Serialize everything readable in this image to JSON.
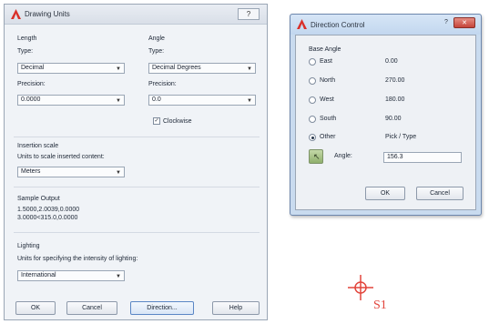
{
  "units_dialog": {
    "title": "Drawing Units",
    "help_label": "?",
    "length": {
      "group_label": "Length",
      "type_label": "Type:",
      "type_value": "Decimal",
      "precision_label": "Precision:",
      "precision_value": "0.0000"
    },
    "angle": {
      "group_label": "Angle",
      "type_label": "Type:",
      "type_value": "Decimal Degrees",
      "precision_label": "Precision:",
      "precision_value": "0.0",
      "clockwise_label": "Clockwise",
      "clockwise_checked": "✓"
    },
    "insertion": {
      "group_label": "Insertion scale",
      "desc": "Units to scale inserted content:",
      "value": "Meters"
    },
    "sample": {
      "group_label": "Sample Output",
      "line1": "1.5000,2.0039,0.0000",
      "line2": "3.0000<315.0,0.0000"
    },
    "lighting": {
      "group_label": "Lighting",
      "desc": "Units for specifying the intensity of lighting:",
      "value": "International"
    },
    "buttons": {
      "ok": "OK",
      "cancel": "Cancel",
      "direction": "Direction...",
      "help": "Help"
    }
  },
  "direction_dialog": {
    "title": "Direction Control",
    "help_label": "?",
    "close_label": "✕",
    "base_angle_label": "Base Angle",
    "options": [
      {
        "label": "East",
        "value": "0.00"
      },
      {
        "label": "North",
        "value": "270.00"
      },
      {
        "label": "West",
        "value": "180.00"
      },
      {
        "label": "South",
        "value": "90.00"
      },
      {
        "label": "Other",
        "value": "Pick / Type"
      }
    ],
    "angle_label": "Angle:",
    "angle_value": "156.3",
    "ok": "OK",
    "cancel": "Cancel"
  },
  "canvas": {
    "marker_label": "S1"
  },
  "colors": {
    "accent_red": "#e2453c",
    "dialog_bg": "#eef1f5",
    "frame_blue": "#c9dbef"
  }
}
